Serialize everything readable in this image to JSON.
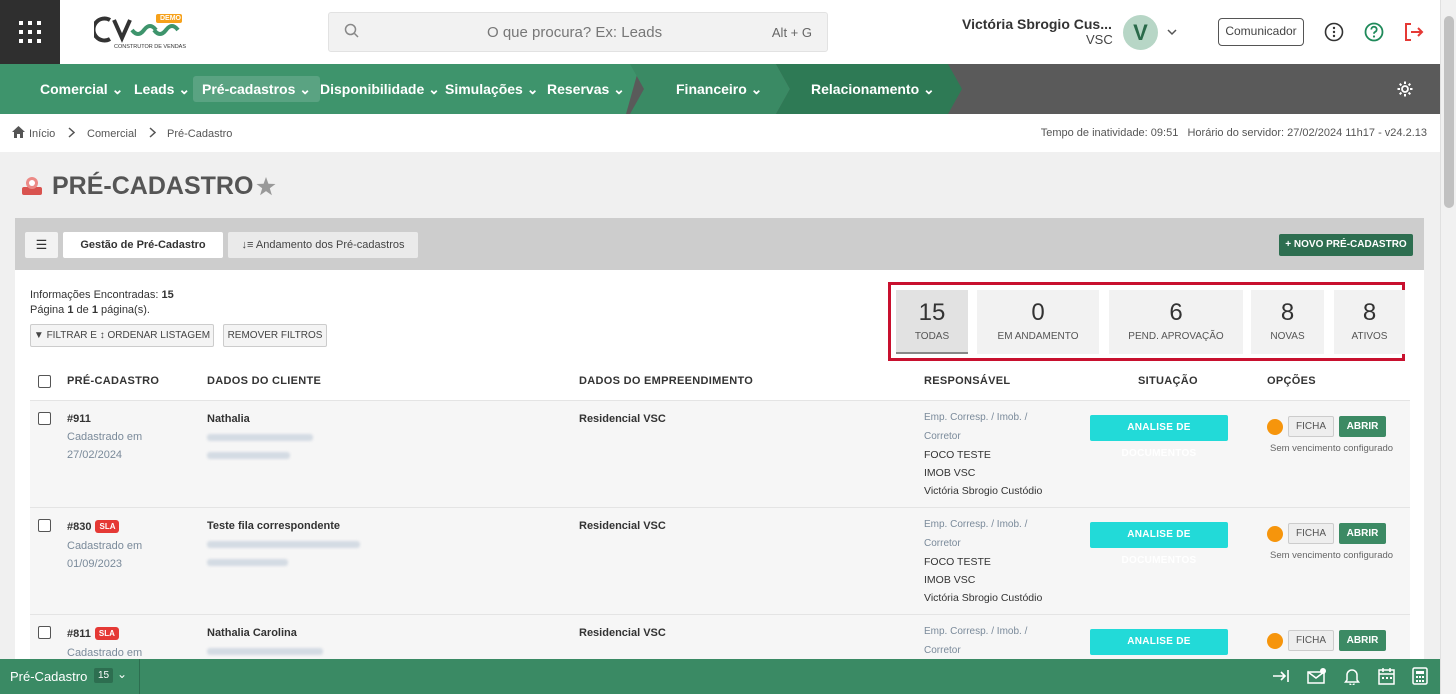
{
  "header": {
    "search_placeholder": "O que procura? Ex: Leads",
    "search_shortcut": "Alt + G",
    "user_name": "Victória Sbrogio Cus...",
    "user_company": "VSC",
    "avatar_letter": "V",
    "communicator_label": "Comunicador",
    "logo_badge": "DEMO",
    "logo_tagline": "CONSTRUTOR DE VENDAS"
  },
  "nav": {
    "items": [
      "Comercial",
      "Leads",
      "Pré-cadastros",
      "Disponibilidade",
      "Simulações",
      "Reservas",
      "Financeiro",
      "Relacionamento"
    ],
    "active": "Pré-cadastros"
  },
  "breadcrumb": {
    "items": [
      "Início",
      "Comercial",
      "Pré-Cadastro"
    ],
    "status": "Tempo de inatividade: 09:51   Horário do servidor: 27/02/2024 11h17 - v24.2.13"
  },
  "page": {
    "title": "PRÉ-CADASTRO"
  },
  "tabs": {
    "menu_icon": "hamburger-icon",
    "gestao": "Gestão de Pré-Cadastro",
    "andamento": "Andamento dos Pré-cadastros",
    "new_button": "NOVO PRÉ-CADASTRO"
  },
  "info": {
    "found_label": "Informações Encontradas:",
    "found_count": "15",
    "page_label": "Página",
    "page_current": "1",
    "page_of": "de",
    "page_total": "1",
    "page_suffix": "página(s).",
    "filter_button": "FILTRAR E ↕ ORDENAR LISTAGEM",
    "remove_button": "REMOVER FILTROS"
  },
  "stats": [
    {
      "value": "15",
      "label": "TODAS"
    },
    {
      "value": "0",
      "label": "EM ANDAMENTO"
    },
    {
      "value": "6",
      "label": "PEND. APROVAÇÃO"
    },
    {
      "value": "8",
      "label": "NOVAS"
    },
    {
      "value": "8",
      "label": "ATIVOS"
    }
  ],
  "table": {
    "headers": [
      "PRÉ-CADASTRO",
      "DADOS DO CLIENTE",
      "DADOS DO EMPREENDIMENTO",
      "RESPONSÁVEL",
      "SITUAÇÃO",
      "OPÇÕES"
    ],
    "rows": [
      {
        "id": "#911",
        "sla": "",
        "reg_label": "Cadastrado em",
        "date": "27/02/2024",
        "client": "Nathalia",
        "project": "Residencial VSC",
        "resp_type": "Emp. Corresp. / Imob. /",
        "resp_type2": "Corretor",
        "resp1": "FOCO TESTE",
        "resp2": "IMOB VSC",
        "resp3": "Victória Sbrogio Custódio",
        "status": "ANALISE DE DOCUMENTOS",
        "ficha": "FICHA",
        "abrir": "ABRIR",
        "venc": "Sem vencimento configurado"
      },
      {
        "id": "#830",
        "sla": "SLA",
        "reg_label": "Cadastrado em",
        "date": "01/09/2023",
        "client": "Teste fila correspondente",
        "project": "Residencial VSC",
        "resp_type": "Emp. Corresp. / Imob. /",
        "resp_type2": "Corretor",
        "resp1": "FOCO TESTE",
        "resp2": "IMOB VSC",
        "resp3": "Victória Sbrogio Custódio",
        "status": "ANALISE DE DOCUMENTOS",
        "ficha": "FICHA",
        "abrir": "ABRIR",
        "venc": "Sem vencimento configurado"
      },
      {
        "id": "#811",
        "sla": "SLA",
        "reg_label": "Cadastrado em",
        "date": "",
        "client": "Nathalia Carolina",
        "project": "Residencial VSC",
        "resp_type": "Emp. Corresp. / Imob. /",
        "resp_type2": "Corretor",
        "resp1": "",
        "resp2": "",
        "resp3": "",
        "status": "ANALISE DE DOCUMENTOS",
        "ficha": "FICHA",
        "abrir": "ABRIR",
        "venc": ""
      }
    ]
  },
  "bottom": {
    "label": "Pré-Cadastro",
    "count": "15"
  },
  "colors": {
    "nav_green": "#3e946c",
    "status_cyan": "#22dad8",
    "sla_red": "#e53935",
    "highlight": "#c8102e"
  }
}
